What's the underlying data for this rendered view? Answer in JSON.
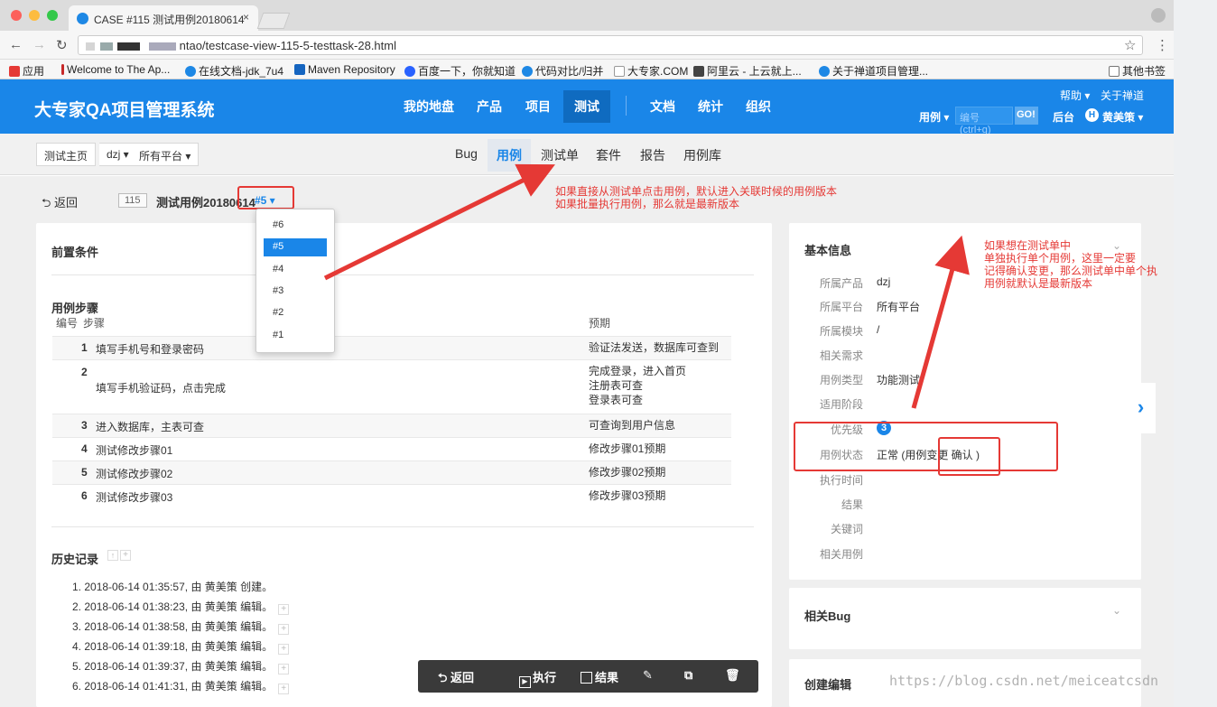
{
  "browser": {
    "tab_title": "CASE #115 测试用例20180614",
    "tab_close": "×",
    "url": "ntao/testcase-view-115-5-testtask-28.html",
    "bookmarks": [
      {
        "label": "应用",
        "color": "#e53935"
      },
      {
        "label": "Welcome to The Ap...",
        "color": "#c62828"
      },
      {
        "label": "在线文档-jdk_7u4",
        "color": "#1e88e5"
      },
      {
        "label": "Maven Repository",
        "color": "#1565c0"
      },
      {
        "label": "百度一下，你就知道",
        "color": "#2962ff"
      },
      {
        "label": "代码对比/归并",
        "color": "#1e88e5"
      },
      {
        "label": "大专家.COM",
        "color": "#9e9e9e"
      },
      {
        "label": "阿里云 - 上云就上...",
        "color": "#444444"
      },
      {
        "label": "关于禅道项目管理...",
        "color": "#1e88e5"
      }
    ],
    "other_bookmarks": "其他书签"
  },
  "app": {
    "brand": "大专家QA项目管理系统",
    "main_nav": [
      "我的地盘",
      "产品",
      "项目",
      "测试",
      "文档",
      "统计",
      "组织"
    ],
    "active_nav": "测试",
    "help": "帮助 ▾",
    "about": "关于禅道",
    "search_type": "用例 ▾",
    "search_placeholder": "编号(ctrl+g)",
    "go": "GO!",
    "backend": "后台",
    "avatar_letter": "H",
    "user": "黄美策 ▾"
  },
  "subnav": {
    "crumbs": [
      "测试主页",
      "dzj ▾",
      "所有平台 ▾"
    ],
    "tabs": [
      "Bug",
      "用例",
      "测试单",
      "套件",
      "报告",
      "用例库"
    ],
    "active": "用例"
  },
  "case": {
    "back": "⮌ 返回",
    "id": "115",
    "title": "测试用例20180614",
    "version": "#5 ▾",
    "versions": [
      "#6",
      "#5",
      "#4",
      "#3",
      "#2",
      "#1"
    ],
    "selected_version": "#5"
  },
  "main": {
    "precondition_title": "前置条件",
    "steps_title": "用例步骤",
    "col_id": "编号",
    "col_step": "步骤",
    "col_expect": "预期",
    "steps": [
      {
        "n": "1",
        "step": "填写手机号和登录密码",
        "expect": [
          "验证法发送，数据库可查到"
        ]
      },
      {
        "n": "2",
        "step": "填写手机验证码，点击完成",
        "expect": [
          "完成登录，进入首页",
          "注册表可查",
          "登录表可查"
        ]
      },
      {
        "n": "3",
        "step": "进入数据库，主表可查",
        "expect": [
          "可查询到用户信息"
        ]
      },
      {
        "n": "4",
        "step": "测试修改步骤01",
        "expect": [
          "修改步骤01预期"
        ]
      },
      {
        "n": "5",
        "step": "测试修改步骤02",
        "expect": [
          "修改步骤02预期"
        ]
      },
      {
        "n": "6",
        "step": "测试修改步骤03",
        "expect": [
          "修改步骤03预期"
        ]
      }
    ],
    "history_title": "历史记录",
    "history": [
      "1. 2018-06-14 01:35:57, 由 黄美策 创建。",
      "2. 2018-06-14 01:38:23, 由 黄美策 编辑。",
      "3. 2018-06-14 01:38:58, 由 黄美策 编辑。",
      "4. 2018-06-14 01:39:18, 由 黄美策 编辑。",
      "5. 2018-06-14 01:39:37, 由 黄美策 编辑。",
      "6. 2018-06-14 01:41:31, 由 黄美策 编辑。"
    ]
  },
  "basic_info": {
    "title": "基本信息",
    "rows": [
      {
        "label": "所属产品",
        "value": "dzj"
      },
      {
        "label": "所属平台",
        "value": "所有平台"
      },
      {
        "label": "所属模块",
        "value": "/"
      },
      {
        "label": "相关需求",
        "value": ""
      },
      {
        "label": "用例类型",
        "value": "功能测试"
      },
      {
        "label": "适用阶段",
        "value": ""
      },
      {
        "label": "优先级",
        "value": "3"
      },
      {
        "label": "用例状态",
        "value": "正常 (用例变更 确认 )"
      },
      {
        "label": "执行时间",
        "value": ""
      },
      {
        "label": "结果",
        "value": ""
      },
      {
        "label": "关键词",
        "value": ""
      },
      {
        "label": "相关用例",
        "value": ""
      }
    ]
  },
  "related_bug": "相关Bug",
  "create_edit": "创建编辑",
  "actions": [
    "⮌ 返回",
    "执行",
    "结果"
  ],
  "annotations": {
    "top": [
      "如果直接从测试单点击用例，默认进入关联时候的用例版本",
      "如果批量执行用例，那么就是最新版本"
    ],
    "right": [
      "如果想在测试单中",
      "单独执行单个用例，这里一定要",
      "记得确认变更，那么测试单中单个执",
      "用例就默认是最新版本"
    ]
  },
  "watermark": "https://blog.csdn.net/meiceatcsdn",
  "colors": {
    "primary": "#1a86e8",
    "annotation": "#e53935"
  }
}
